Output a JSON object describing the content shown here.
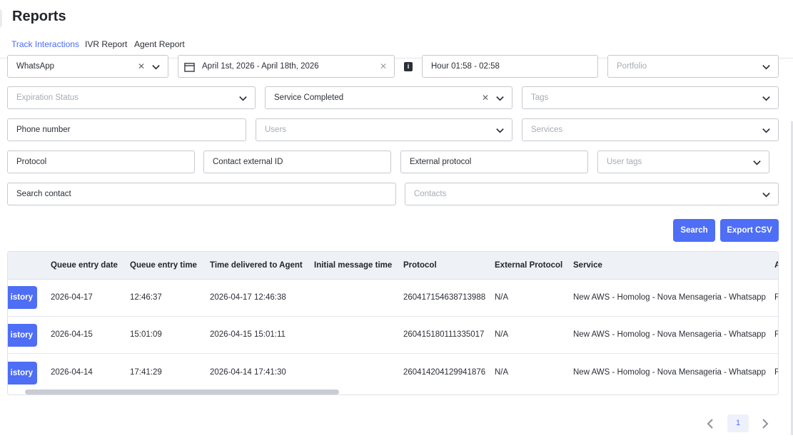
{
  "page": {
    "title": "Reports"
  },
  "tabs": [
    "Track Interactions",
    "IVR Report",
    "Agent Report"
  ],
  "filters": {
    "channel": "WhatsApp",
    "date_range": "April 1st, 2026 - April 18th, 2026",
    "hour": "Hour 01:58 - 02:58",
    "portfolio_placeholder": "Portfolio",
    "expiration_placeholder": "Expiration Status",
    "status": "Service Completed",
    "tags_placeholder": "Tags",
    "phone_placeholder": "Phone number",
    "users_placeholder": "Users",
    "services_placeholder": "Services",
    "protocol_placeholder": "Protocol",
    "contact_external_id_placeholder": "Contact external ID",
    "external_protocol_placeholder": "External protocol",
    "user_tags_placeholder": "User tags",
    "search_contact_placeholder": "Search contact",
    "contacts_placeholder": "Contacts"
  },
  "actions": {
    "search_label": "Search",
    "export_label": "Export CSV"
  },
  "table": {
    "columns": [
      "Queue entry date",
      "Queue entry time",
      "Time delivered to Agent",
      "Initial message time",
      "Protocol",
      "External Protocol",
      "Service",
      "A"
    ],
    "history_label": "istory",
    "rows": [
      {
        "date": "2026-04-17",
        "time": "12:46:37",
        "delivered": "2026-04-17 12:46:38",
        "initial": "",
        "protocol": "260417154638713988",
        "external": "N/A",
        "service": "New AWS - Homolog - Nova Mensageria - Whatsapp",
        "extra": "F"
      },
      {
        "date": "2026-04-15",
        "time": "15:01:09",
        "delivered": "2026-04-15 15:01:11",
        "initial": "",
        "protocol": "260415180111335017",
        "external": "N/A",
        "service": "New AWS - Homolog - Nova Mensageria - Whatsapp",
        "extra": "F"
      },
      {
        "date": "2026-04-14",
        "time": "17:41:29",
        "delivered": "2026-04-14 17:41:30",
        "initial": "",
        "protocol": "260414204129941876",
        "external": "N/A",
        "service": "New AWS - Homolog - Nova Mensageria - Whatsapp",
        "extra": "F"
      }
    ]
  },
  "pagination": {
    "current_page": "1"
  },
  "colors": {
    "accent": "#4e6ef5",
    "tab_active": "#4a6cf7"
  }
}
